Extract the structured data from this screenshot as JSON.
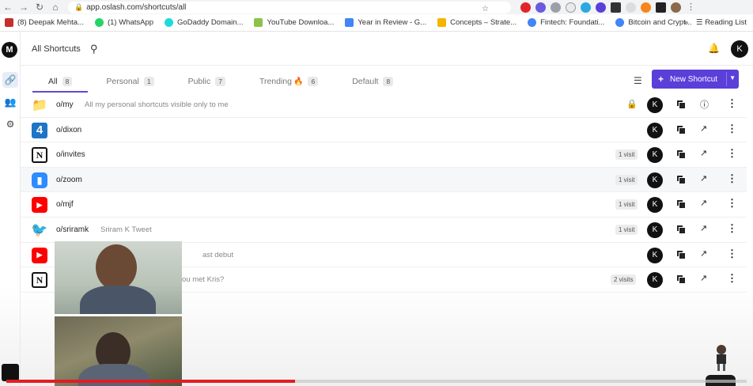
{
  "browser": {
    "url": "app.oslash.com/shortcuts/all",
    "bookmarks": [
      {
        "label": "(8) Deepak Mehta...",
        "color": "#c4302b"
      },
      {
        "label": "(1) WhatsApp",
        "color": "#25d366"
      },
      {
        "label": "GoDaddy Domain...",
        "color": "#1bdbdb"
      },
      {
        "label": "YouTube Downloa...",
        "color": "#8bc34a"
      },
      {
        "label": "Year in Review - G...",
        "color": "#4285f4"
      },
      {
        "label": "Concepts – Strate...",
        "color": "#f5b400"
      },
      {
        "label": "Fintech: Foundati...",
        "color": "#4285f4"
      },
      {
        "label": "Bitcoin and Crypt...",
        "color": "#4285f4"
      }
    ],
    "reading_list": "Reading List",
    "more": "»"
  },
  "app": {
    "workspace_initial": "M",
    "header_title": "All Shortcuts",
    "user_initial": "K",
    "new_shortcut_label": "New Shortcut",
    "tabs": [
      {
        "label": "All",
        "count": "8",
        "active": true
      },
      {
        "label": "Personal",
        "count": "1"
      },
      {
        "label": "Public",
        "count": "7"
      },
      {
        "label": "Trending",
        "count": "6",
        "emoji": "🔥"
      },
      {
        "label": "Default",
        "count": "8"
      }
    ],
    "rows": [
      {
        "name": "o/my",
        "desc": "All my personal shortcuts visible only to me",
        "icon": "folder-icon",
        "visits": "",
        "locked": true
      },
      {
        "name": "o/dixon",
        "desc": "",
        "icon": "channel4-icon",
        "visits": ""
      },
      {
        "name": "o/invites",
        "desc": "",
        "icon": "notion-icon",
        "visits": "1 visit"
      },
      {
        "name": "o/zoom",
        "desc": "",
        "icon": "zoom-icon",
        "visits": "1 visit"
      },
      {
        "name": "o/mjf",
        "desc": "",
        "icon": "youtube-icon",
        "visits": "1 visit"
      },
      {
        "name": "o/sriramk",
        "desc": "Sriram K Tweet",
        "icon": "twitter-icon",
        "visits": "1 visit"
      },
      {
        "name": "",
        "desc": "ast debut",
        "icon": "youtube-icon",
        "visits": ""
      },
      {
        "name": "",
        "desc": "ou met Kris?",
        "icon": "notion-icon",
        "visits": "2 visits"
      }
    ],
    "owner_initial": "K"
  },
  "video": {
    "progress_fraction": 0.39
  }
}
